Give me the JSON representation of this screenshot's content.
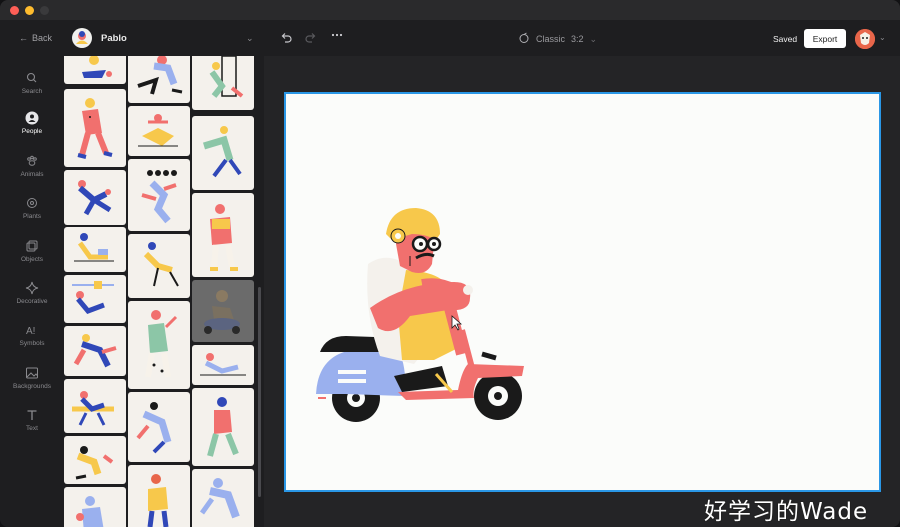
{
  "app": {
    "back_label": "Back",
    "project_name": "Pablo",
    "canvas_label": "Classic",
    "canvas_ratio": "3:2",
    "saved_label": "Saved",
    "export_label": "Export"
  },
  "nav": {
    "items": [
      {
        "label": "Search",
        "icon": "search-icon"
      },
      {
        "label": "People",
        "icon": "person-icon",
        "active": true
      },
      {
        "label": "Animals",
        "icon": "paw-icon"
      },
      {
        "label": "Plants",
        "icon": "flower-icon"
      },
      {
        "label": "Objects",
        "icon": "objects-icon"
      },
      {
        "label": "Decorative",
        "icon": "sparkle-icon"
      },
      {
        "label": "Symbols",
        "icon": "symbols-icon"
      },
      {
        "label": "Backgrounds",
        "icon": "image-icon"
      },
      {
        "label": "Text",
        "icon": "text-icon"
      }
    ]
  },
  "colors": {
    "accent": "#2a97e6",
    "skin": "#f1706e",
    "yellow": "#f7c84b",
    "scooter_blue": "#9ab0ee",
    "dark": "#1a1a1a"
  },
  "watermark": "好学习的Wade"
}
